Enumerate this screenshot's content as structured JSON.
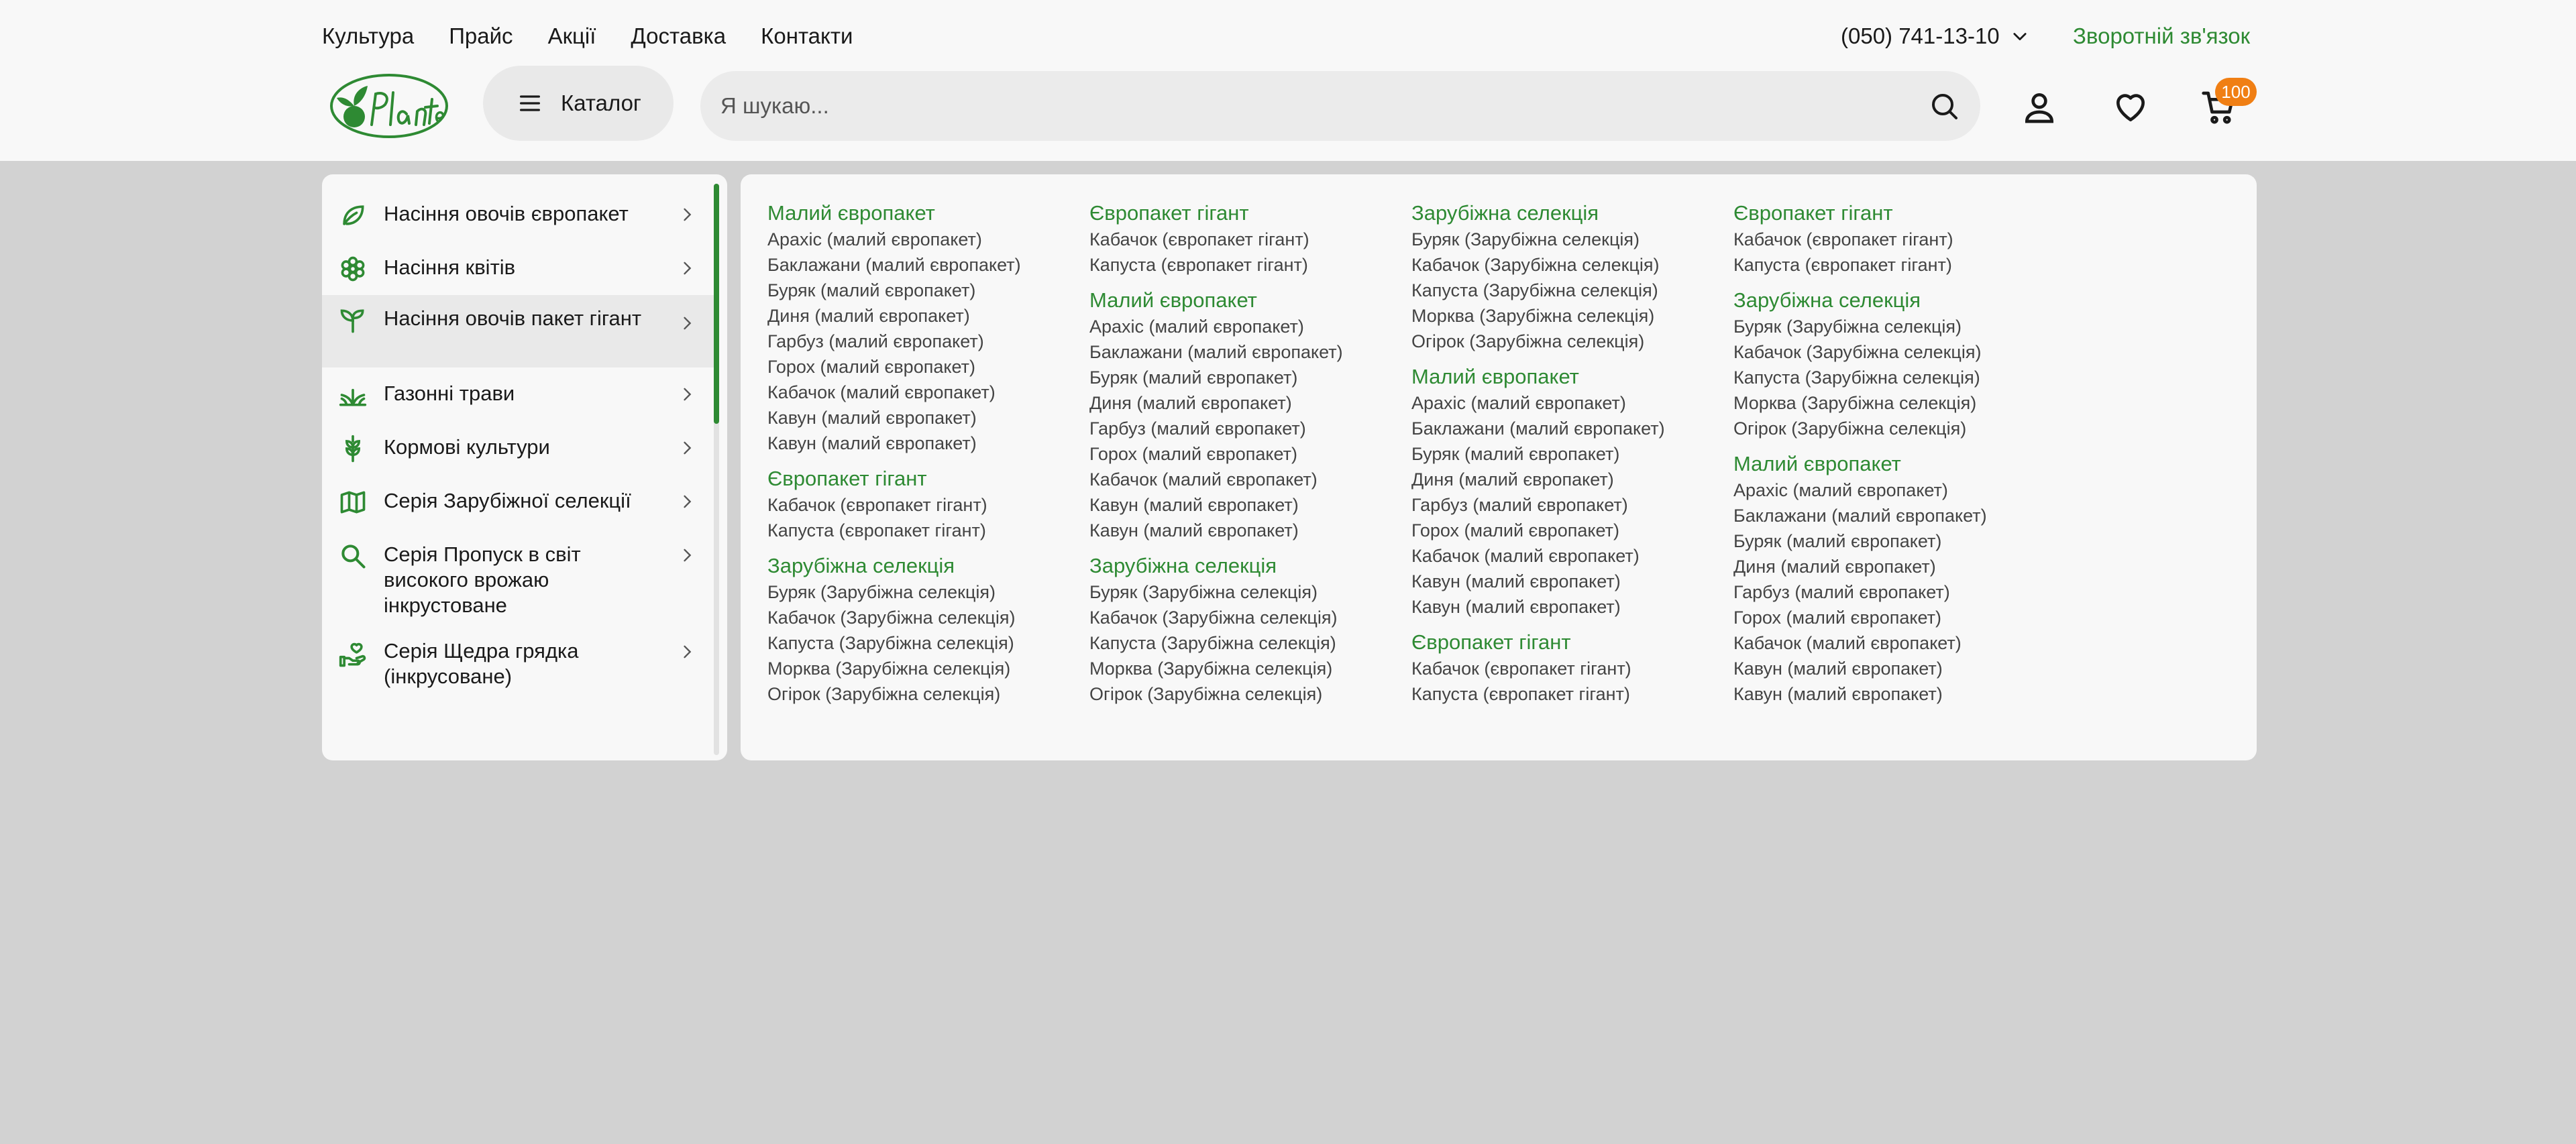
{
  "topnav": [
    "Культура",
    "Прайс",
    "Акції",
    "Доставка",
    "Контакти"
  ],
  "phone": "(050) 741-13-10",
  "callback": "Зворотній зв'язок",
  "logo_text": "oPlante",
  "catalog_label": "Каталог",
  "search": {
    "placeholder": "Я шукаю..."
  },
  "cart_count": "100",
  "colors": {
    "accent": "#2e8a33",
    "badge": "#f07f14",
    "overlay": "#d2d2d2"
  },
  "categories": [
    {
      "label": "Насіння овочів європакет",
      "icon": "leaf-icon"
    },
    {
      "label": "Насіння квітів",
      "icon": "flower-icon"
    },
    {
      "label": "Насіння овочів пакет гігант",
      "icon": "sprout-icon",
      "active": true
    },
    {
      "label": "Газонні трави",
      "icon": "grass-icon"
    },
    {
      "label": "Кормові культури",
      "icon": "wheat-icon"
    },
    {
      "label": "Серія Зарубіжної селекції",
      "icon": "map-icon"
    },
    {
      "label": "Серія Пропуск в світ високого врожаю інкрустоване",
      "icon": "search-icon"
    },
    {
      "label": "Серія Щедра грядка (інкрусоване)",
      "icon": "hand-heart-icon"
    }
  ],
  "menu_columns": [
    [
      {
        "title": "Малий європакет",
        "items": [
          "Арахіс (малий європакет)",
          "Баклажани (малий європакет)",
          "Буряк (малий європакет)",
          "Диня (малий європакет)",
          "Гарбуз (малий європакет)",
          "Горох (малий європакет)",
          "Кабачок (малий європакет)",
          "Кавун (малий європакет)",
          "Кавун (малий європакет)"
        ]
      },
      {
        "title": "Європакет гігант",
        "items": [
          "Кабачок (європакет гігант)",
          "Капуста (європакет гігант)"
        ]
      },
      {
        "title": "Зарубіжна селекція",
        "items": [
          "Буряк (Зарубіжна селекція)",
          "Кабачок (Зарубіжна селекція)",
          "Капуста (Зарубіжна селекція)",
          "Морква (Зарубіжна селекція)",
          "Огірок (Зарубіжна селекція)"
        ]
      }
    ],
    [
      {
        "title": "Європакет гігант",
        "items": [
          "Кабачок (європакет гігант)",
          "Капуста (європакет гігант)"
        ]
      },
      {
        "title": "Малий європакет",
        "items": [
          "Арахіс (малий європакет)",
          "Баклажани (малий європакет)",
          "Буряк (малий європакет)",
          "Диня (малий європакет)",
          "Гарбуз (малий європакет)",
          "Горох (малий європакет)",
          "Кабачок (малий європакет)",
          "Кавун (малий європакет)",
          "Кавун (малий європакет)"
        ]
      },
      {
        "title": "Зарубіжна селекція",
        "items": [
          "Буряк (Зарубіжна селекція)",
          "Кабачок (Зарубіжна селекція)",
          "Капуста (Зарубіжна селекція)",
          "Морква (Зарубіжна селекція)",
          "Огірок (Зарубіжна селекція)"
        ]
      }
    ],
    [
      {
        "title": "Зарубіжна селекція",
        "items": [
          "Буряк (Зарубіжна селекція)",
          "Кабачок (Зарубіжна селекція)",
          "Капуста (Зарубіжна селекція)",
          "Морква (Зарубіжна селекція)",
          "Огірок (Зарубіжна селекція)"
        ]
      },
      {
        "title": "Малий європакет",
        "items": [
          "Арахіс (малий європакет)",
          "Баклажани (малий європакет)",
          "Буряк (малий європакет)",
          "Диня (малий європакет)",
          "Гарбуз (малий європакет)",
          "Горох (малий європакет)",
          "Кабачок (малий європакет)",
          "Кавун (малий європакет)",
          "Кавун (малий європакет)"
        ]
      },
      {
        "title": "Європакет гігант",
        "items": [
          "Кабачок (європакет гігант)",
          "Капуста (європакет гігант)"
        ]
      }
    ],
    [
      {
        "title": "Європакет гігант",
        "items": [
          "Кабачок (європакет гігант)",
          "Капуста (європакет гігант)"
        ]
      },
      {
        "title": "Зарубіжна селекція",
        "items": [
          "Буряк (Зарубіжна селекція)",
          "Кабачок (Зарубіжна селекція)",
          "Капуста (Зарубіжна селекція)",
          "Морква (Зарубіжна селекція)",
          "Огірок (Зарубіжна селекція)"
        ]
      },
      {
        "title": "Малий європакет",
        "items": [
          "Арахіс (малий європакет)",
          "Баклажани (малий європакет)",
          "Буряк (малий європакет)",
          "Диня (малий європакет)",
          "Гарбуз (малий європакет)",
          "Горох (малий європакет)",
          "Кабачок (малий європакет)",
          "Кавун (малий європакет)",
          "Кавун (малий європакет)"
        ]
      }
    ]
  ]
}
